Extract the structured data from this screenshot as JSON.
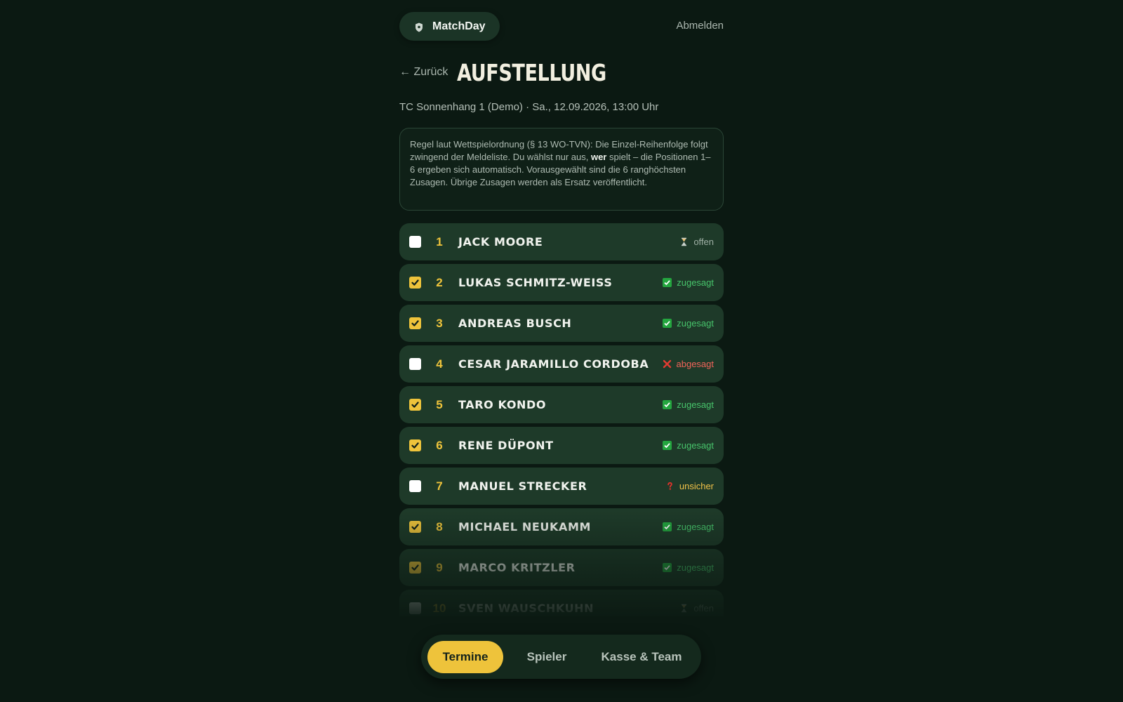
{
  "header": {
    "app_name": "MatchDay",
    "logout_label": "Abmelden"
  },
  "page": {
    "back_label": "← Zurück",
    "title": "AUFSTELLUNG",
    "subtitle": "TC Sonnenhang 1 (Demo) · Sa., 12.09.2026, 13:00 Uhr",
    "rule_text_before": "Regel laut Wettspielordnung (§ 13 WO-TVN): Die Einzel-Reihenfolge folgt zwingend der Meldeliste. Du wählst nur aus, ",
    "rule_text_bold": "wer",
    "rule_text_after": " spielt – die Positionen 1–6 ergeben sich automatisch. Vorausgewählt sind die 6 ranghöchsten Zusagen. Übrige Zusagen werden als Ersatz veröffentlicht."
  },
  "players": [
    {
      "rank": "1",
      "name": "JACK MOORE",
      "checked": false,
      "status": "offen",
      "status_type": "offen"
    },
    {
      "rank": "2",
      "name": "LUKAS SCHMITZ-WEISS",
      "checked": true,
      "status": "zugesagt",
      "status_type": "zugesagt"
    },
    {
      "rank": "3",
      "name": "ANDREAS BUSCH",
      "checked": true,
      "status": "zugesagt",
      "status_type": "zugesagt"
    },
    {
      "rank": "4",
      "name": "CESAR JARAMILLO CORDOBA",
      "checked": false,
      "status": "abgesagt",
      "status_type": "abgesagt"
    },
    {
      "rank": "5",
      "name": "TARO KONDO",
      "checked": true,
      "status": "zugesagt",
      "status_type": "zugesagt"
    },
    {
      "rank": "6",
      "name": "RENE DÜPONT",
      "checked": true,
      "status": "zugesagt",
      "status_type": "zugesagt"
    },
    {
      "rank": "7",
      "name": "MANUEL STRECKER",
      "checked": false,
      "status": "unsicher",
      "status_type": "unsicher"
    },
    {
      "rank": "8",
      "name": "MICHAEL NEUKAMM",
      "checked": true,
      "status": "zugesagt",
      "status_type": "zugesagt"
    },
    {
      "rank": "9",
      "name": "MARCO KRITZLER",
      "checked": true,
      "status": "zugesagt",
      "status_type": "zugesagt"
    },
    {
      "rank": "10",
      "name": "SVEN WAUSCHKUHN",
      "checked": false,
      "status": "offen",
      "status_type": "offen"
    }
  ],
  "nav": {
    "items": [
      {
        "label": "Termine",
        "active": true
      },
      {
        "label": "Spieler",
        "active": false
      },
      {
        "label": "Kasse & Team",
        "active": false
      }
    ]
  },
  "colors": {
    "background": "#0b1912",
    "row": "#1e3a29",
    "accent": "#eec33b",
    "zugesagt": "#47c46b",
    "abgesagt": "#f0645a",
    "unsicher": "#f0c148"
  }
}
